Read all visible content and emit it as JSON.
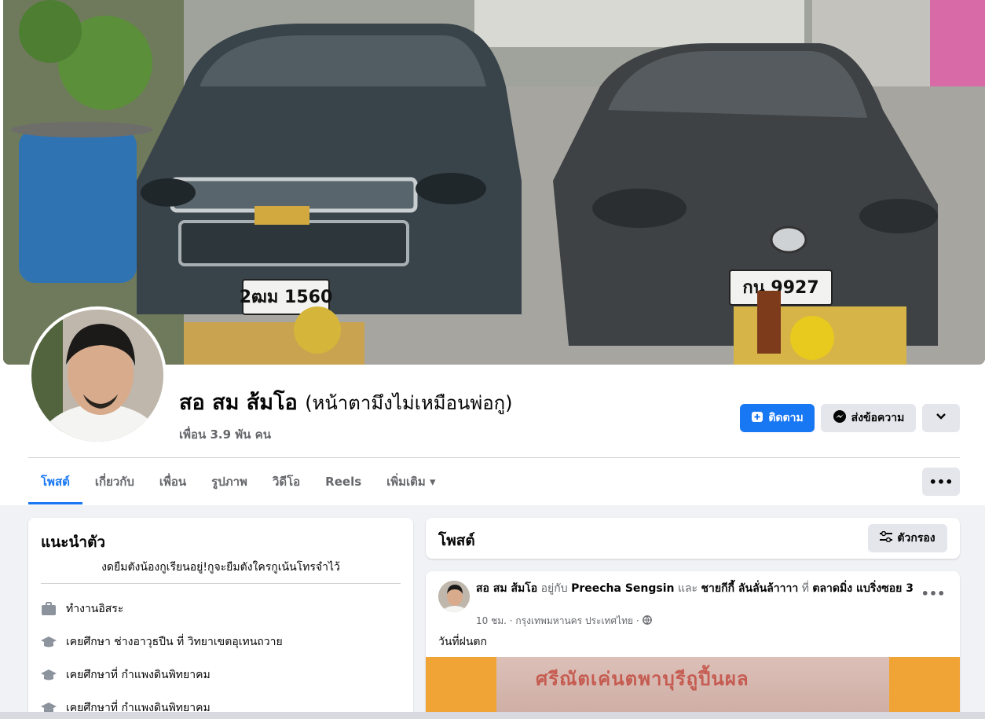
{
  "profile": {
    "name": "สอ สม ส้มโอ",
    "nickname": "(หน้าตามึงไม่เหมือนพ่อกู)",
    "friends": "เพื่อน 3.9 พัน คน",
    "cover_plates": {
      "left": "2ฒม 1560",
      "right": "กน 9927"
    }
  },
  "actions": {
    "follow_label": "ติดตาม",
    "message_label": "ส่งข้อความ"
  },
  "tabs": [
    {
      "label": "โพสต์",
      "active": true
    },
    {
      "label": "เกี่ยวกับ"
    },
    {
      "label": "เพื่อน"
    },
    {
      "label": "รูปภาพ"
    },
    {
      "label": "วิดีโอ"
    },
    {
      "label": "Reels"
    },
    {
      "label": "เพิ่มเติม ▾"
    }
  ],
  "intro": {
    "title": "แนะนำตัว",
    "bio": "งดยืมตังน้องกูเรียนอยู่!กูจะยืมตังใครกูเน้นโทรจำไว้",
    "items": [
      {
        "icon": "briefcase-icon",
        "text": "ทำงานอิสระ"
      },
      {
        "icon": "graduation-cap-icon",
        "text": "เคยศึกษา ช่างอาวุธปืน ที่ วิทยาเขตอุเทนถวาย"
      },
      {
        "icon": "graduation-cap-icon",
        "text": "เคยศึกษาที่ กำแพงดินพิทยาคม"
      },
      {
        "icon": "graduation-cap-icon",
        "text": "เคยศึกษาที่ กำแพงดินพิทยาคม"
      }
    ]
  },
  "posts": {
    "title": "โพสต์",
    "filter_label": "ตัวกรอง"
  },
  "post": {
    "author": "สอ สม ส้มโอ",
    "with_word": "อยู่กับ",
    "tagged1": "Preecha Sengsin",
    "and_word": "และ",
    "tagged2": "ชายกีกี้ ลันลั่นล้าาาา",
    "at_word": "ที่",
    "location": "ตลาดมิ่ง แบริ่งซอย 3",
    "time": "10 ชม. · กรุงเทพมหานคร ประเทศไทย ·",
    "text": "วันที่ฝนตก",
    "banner_text": "ศรีณัตเค่นตพาบุรีถูปี้นผล"
  },
  "colors": {
    "accent": "#1877f2",
    "secondary_text": "#65676b",
    "button_gray": "#e4e6eb",
    "background": "#f0f2f5"
  }
}
